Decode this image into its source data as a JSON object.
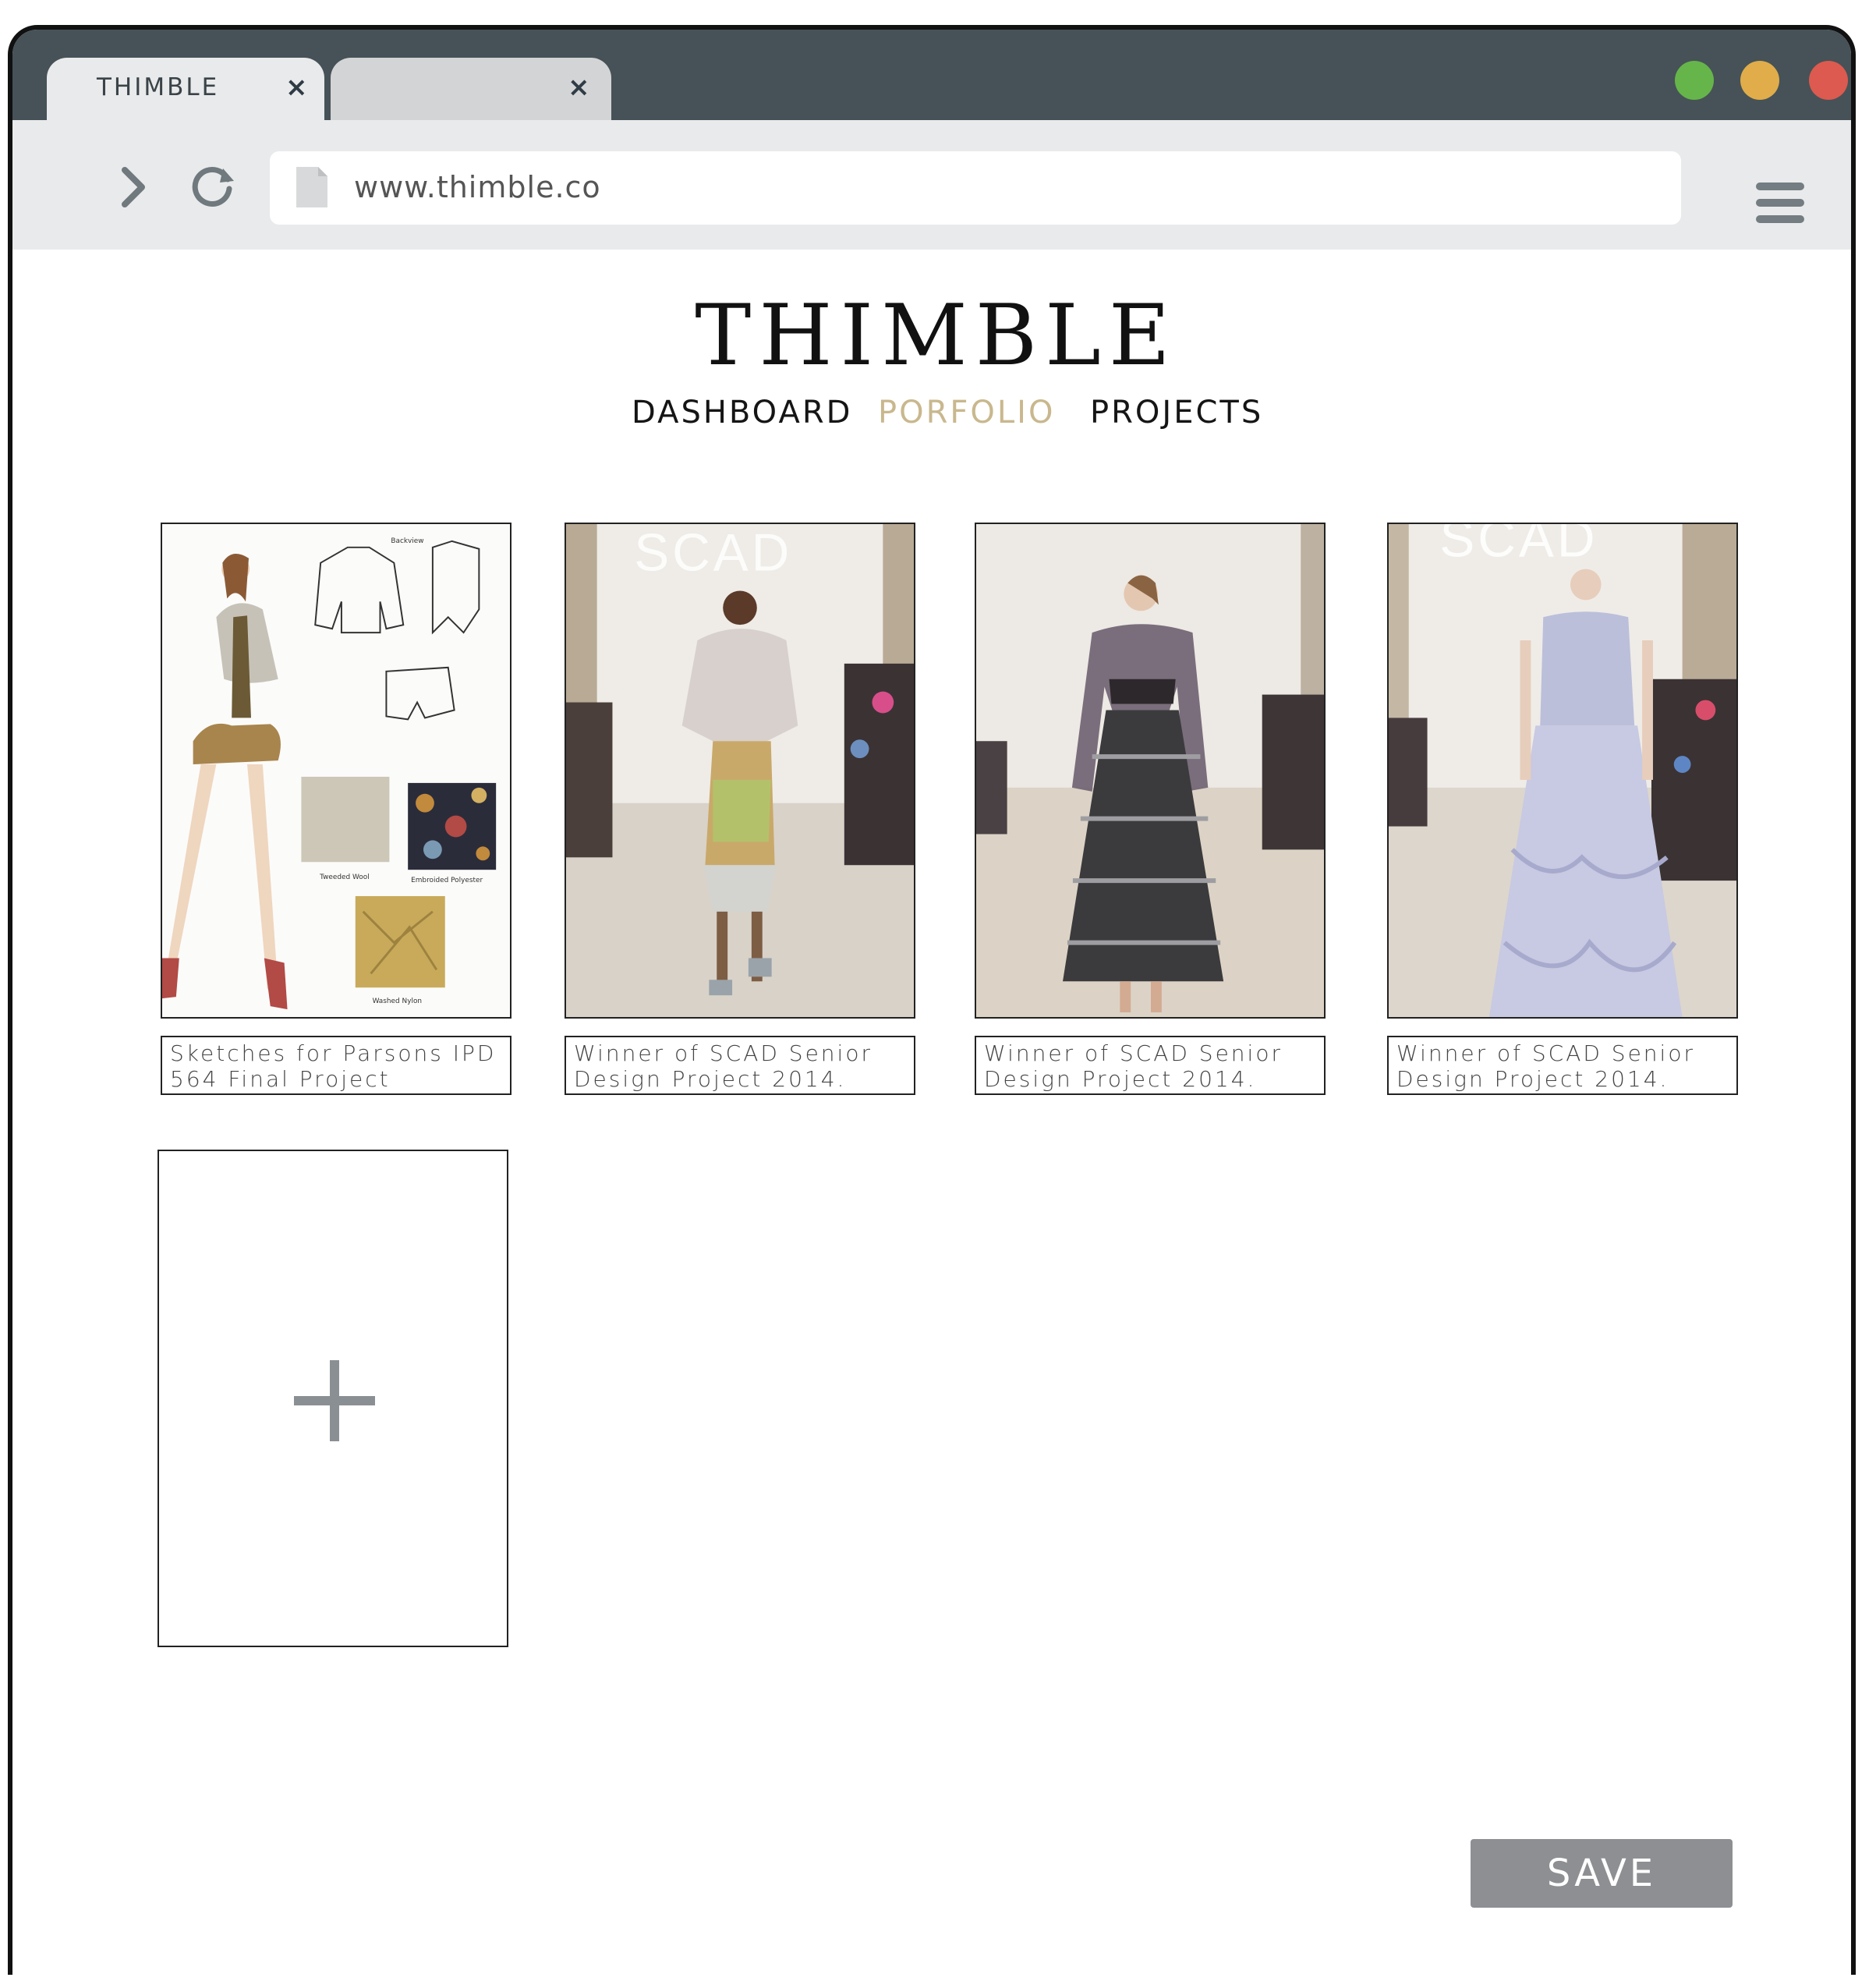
{
  "browser": {
    "tabs": [
      {
        "label": "THIMBLE",
        "close": "×"
      },
      {
        "label": "",
        "close": "×"
      }
    ],
    "url": "www.thimble.co"
  },
  "site": {
    "brand": "THIMBLE",
    "nav": [
      {
        "label": "DASHBOARD",
        "active": false
      },
      {
        "label": "PORFOLIO",
        "active": true
      },
      {
        "label": "PROJECTS",
        "active": false
      }
    ],
    "accent_color": "#c9b88e"
  },
  "portfolio": {
    "items": [
      {
        "caption": "Sketches for Parsons IPD 564 Final Project",
        "image": "fashion-sketch-board",
        "labels": [
          "Backview",
          "Tweeded Wool",
          "Embroided Polyester",
          "Washed Nylon"
        ]
      },
      {
        "caption": "Winner of SCAD Senior Design Project 2014.",
        "image": "runway-model-1",
        "sign": "SCAD"
      },
      {
        "caption": "Winner of SCAD Senior Design Project 2014.",
        "image": "runway-model-2"
      },
      {
        "caption": "Winner of SCAD Senior Design Project 2014.",
        "image": "runway-model-3",
        "sign": "SCAD"
      }
    ],
    "add_button_icon": "plus-icon"
  },
  "actions": {
    "save_label": "SAVE"
  }
}
